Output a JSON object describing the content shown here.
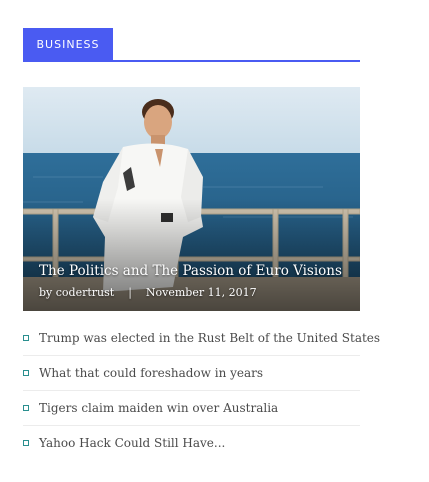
{
  "section": {
    "label": "BUSINESS"
  },
  "featured": {
    "title": "The Politics and The Passion of Euro Visions",
    "author": "by codertrust",
    "separator": "|",
    "date": "November 11, 2017"
  },
  "posts": [
    {
      "title": "Trump was elected in the Rust Belt of the United States"
    },
    {
      "title": "What that could foreshadow in years"
    },
    {
      "title": "Tigers claim maiden win over Australia"
    },
    {
      "title": "Yahoo Hack Could Still Have..."
    }
  ],
  "colors": {
    "accent": "#4a5bf2",
    "bullet": "#2a8f8f",
    "text": "#4a4a4a"
  }
}
